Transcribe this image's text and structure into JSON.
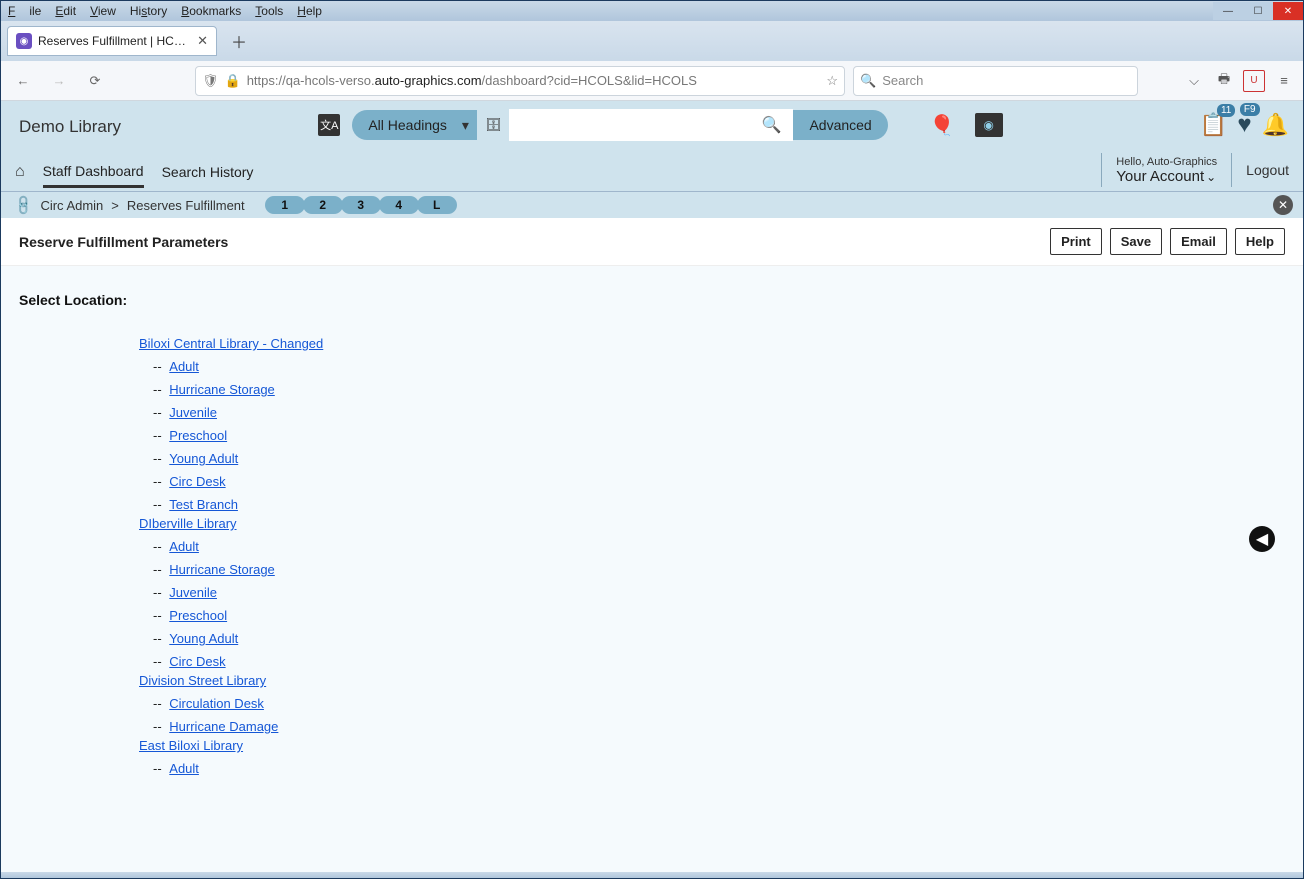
{
  "menus": {
    "file": "File",
    "edit": "Edit",
    "view": "View",
    "history": "History",
    "bookmarks": "Bookmarks",
    "tools": "Tools",
    "help": "Help"
  },
  "tab": {
    "title": "Reserves Fulfillment | HCOLS | h"
  },
  "url": {
    "prefix": "https://qa-hcols-verso.",
    "bold": "auto-graphics.com",
    "suffix": "/dashboard?cid=HCOLS&lid=HCOLS"
  },
  "browser_search_placeholder": "Search",
  "library_name": "Demo Library",
  "headings_label": "All Headings",
  "advanced_label": "Advanced",
  "list_badge": "11",
  "fav_badge": "F9",
  "nav": {
    "staff": "Staff Dashboard",
    "history": "Search History"
  },
  "account": {
    "greet": "Hello, Auto-Graphics",
    "name": "Your Account",
    "logout": "Logout"
  },
  "breadcrumb": {
    "a": "Circ Admin",
    "sep": ">",
    "b": "Reserves Fulfillment"
  },
  "pills": [
    "1",
    "2",
    "3",
    "4",
    "L"
  ],
  "page_title": "Reserve Fulfillment Parameters",
  "actions": {
    "print": "Print",
    "save": "Save",
    "email": "Email",
    "help": "Help"
  },
  "select_label": "Select Location:",
  "locations": [
    {
      "name": "Biloxi Central Library - Changed",
      "subs": [
        "Adult",
        "Hurricane Storage",
        "Juvenile",
        "Preschool",
        "Young Adult",
        "Circ Desk",
        "Test Branch"
      ]
    },
    {
      "name": "DIberville Library",
      "subs": [
        "Adult",
        "Hurricane Storage",
        "Juvenile",
        "Preschool",
        "Young Adult",
        "Circ Desk"
      ]
    },
    {
      "name": "Division Street Library",
      "subs": [
        "Circulation Desk",
        "Hurricane Damage"
      ]
    },
    {
      "name": "East Biloxi Library",
      "subs": [
        "Adult"
      ]
    }
  ]
}
